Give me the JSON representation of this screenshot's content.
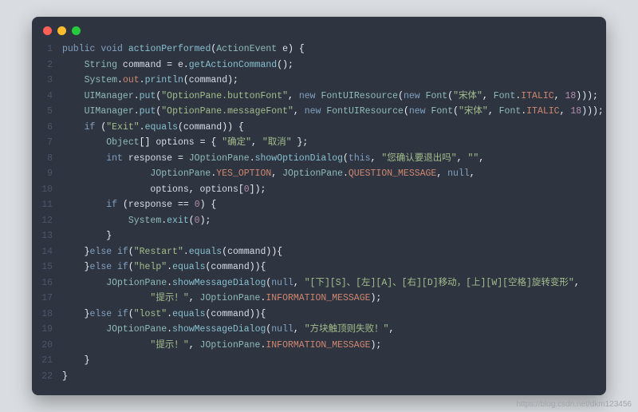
{
  "watermark": "https://blog.csdn.net/dkm123456",
  "lineCount": 22,
  "code": [
    [
      [
        "k",
        "public"
      ],
      [
        "v",
        " "
      ],
      [
        "k",
        "void"
      ],
      [
        "v",
        " "
      ],
      [
        "m",
        "actionPerformed"
      ],
      [
        "p",
        "("
      ],
      [
        "t",
        "ActionEvent"
      ],
      [
        "v",
        " e"
      ],
      [
        "p",
        ") {"
      ]
    ],
    [
      [
        "v",
        "    "
      ],
      [
        "t",
        "String"
      ],
      [
        "v",
        " command "
      ],
      [
        "p",
        "="
      ],
      [
        "v",
        " e"
      ],
      [
        "p",
        "."
      ],
      [
        "m",
        "getActionCommand"
      ],
      [
        "p",
        "();"
      ]
    ],
    [
      [
        "v",
        "    "
      ],
      [
        "t",
        "System"
      ],
      [
        "p",
        "."
      ],
      [
        "c",
        "out"
      ],
      [
        "p",
        "."
      ],
      [
        "m",
        "println"
      ],
      [
        "p",
        "("
      ],
      [
        "v",
        "command"
      ],
      [
        "p",
        ");"
      ]
    ],
    [
      [
        "v",
        "    "
      ],
      [
        "t",
        "UIManager"
      ],
      [
        "p",
        "."
      ],
      [
        "m",
        "put"
      ],
      [
        "p",
        "("
      ],
      [
        "s",
        "\"OptionPane.buttonFont\""
      ],
      [
        "p",
        ", "
      ],
      [
        "k",
        "new"
      ],
      [
        "v",
        " "
      ],
      [
        "t",
        "FontUIResource"
      ],
      [
        "p",
        "("
      ],
      [
        "k",
        "new"
      ],
      [
        "v",
        " "
      ],
      [
        "t",
        "Font"
      ],
      [
        "p",
        "("
      ],
      [
        "s",
        "\"宋体\""
      ],
      [
        "p",
        ", "
      ],
      [
        "t",
        "Font"
      ],
      [
        "p",
        "."
      ],
      [
        "c",
        "ITALIC"
      ],
      [
        "p",
        ", "
      ],
      [
        "n",
        "18"
      ],
      [
        "p",
        ")));"
      ]
    ],
    [
      [
        "v",
        "    "
      ],
      [
        "t",
        "UIManager"
      ],
      [
        "p",
        "."
      ],
      [
        "m",
        "put"
      ],
      [
        "p",
        "("
      ],
      [
        "s",
        "\"OptionPane.messageFont\""
      ],
      [
        "p",
        ", "
      ],
      [
        "k",
        "new"
      ],
      [
        "v",
        " "
      ],
      [
        "t",
        "FontUIResource"
      ],
      [
        "p",
        "("
      ],
      [
        "k",
        "new"
      ],
      [
        "v",
        " "
      ],
      [
        "t",
        "Font"
      ],
      [
        "p",
        "("
      ],
      [
        "s",
        "\"宋体\""
      ],
      [
        "p",
        ", "
      ],
      [
        "t",
        "Font"
      ],
      [
        "p",
        "."
      ],
      [
        "c",
        "ITALIC"
      ],
      [
        "p",
        ", "
      ],
      [
        "n",
        "18"
      ],
      [
        "p",
        ")));"
      ]
    ],
    [
      [
        "v",
        "    "
      ],
      [
        "k",
        "if"
      ],
      [
        "v",
        " "
      ],
      [
        "p",
        "("
      ],
      [
        "s",
        "\"Exit\""
      ],
      [
        "p",
        "."
      ],
      [
        "m",
        "equals"
      ],
      [
        "p",
        "("
      ],
      [
        "v",
        "command"
      ],
      [
        "p",
        ")) {"
      ]
    ],
    [
      [
        "v",
        "        "
      ],
      [
        "t",
        "Object"
      ],
      [
        "p",
        "[]"
      ],
      [
        "v",
        " options "
      ],
      [
        "p",
        "= { "
      ],
      [
        "s",
        "\"确定\""
      ],
      [
        "p",
        ", "
      ],
      [
        "s",
        "\"取消\""
      ],
      [
        "p",
        " };"
      ]
    ],
    [
      [
        "v",
        "        "
      ],
      [
        "k",
        "int"
      ],
      [
        "v",
        " response "
      ],
      [
        "p",
        "= "
      ],
      [
        "t",
        "JOptionPane"
      ],
      [
        "p",
        "."
      ],
      [
        "m",
        "showOptionDialog"
      ],
      [
        "p",
        "("
      ],
      [
        "k",
        "this"
      ],
      [
        "p",
        ", "
      ],
      [
        "s",
        "\"您确认要退出吗\""
      ],
      [
        "p",
        ", "
      ],
      [
        "s",
        "\"\""
      ],
      [
        "p",
        ","
      ]
    ],
    [
      [
        "v",
        "                "
      ],
      [
        "t",
        "JOptionPane"
      ],
      [
        "p",
        "."
      ],
      [
        "c",
        "YES_OPTION"
      ],
      [
        "p",
        ", "
      ],
      [
        "t",
        "JOptionPane"
      ],
      [
        "p",
        "."
      ],
      [
        "c",
        "QUESTION_MESSAGE"
      ],
      [
        "p",
        ", "
      ],
      [
        "k",
        "null"
      ],
      [
        "p",
        ","
      ]
    ],
    [
      [
        "v",
        "                options"
      ],
      [
        "p",
        ", "
      ],
      [
        "v",
        "options"
      ],
      [
        "p",
        "["
      ],
      [
        "n",
        "0"
      ],
      [
        "p",
        "]);"
      ]
    ],
    [
      [
        "v",
        "        "
      ],
      [
        "k",
        "if"
      ],
      [
        "v",
        " "
      ],
      [
        "p",
        "("
      ],
      [
        "v",
        "response "
      ],
      [
        "p",
        "== "
      ],
      [
        "n",
        "0"
      ],
      [
        "p",
        ") {"
      ]
    ],
    [
      [
        "v",
        "            "
      ],
      [
        "t",
        "System"
      ],
      [
        "p",
        "."
      ],
      [
        "m",
        "exit"
      ],
      [
        "p",
        "("
      ],
      [
        "n",
        "0"
      ],
      [
        "p",
        ");"
      ]
    ],
    [
      [
        "v",
        "        "
      ],
      [
        "p",
        "}"
      ]
    ],
    [
      [
        "v",
        "    "
      ],
      [
        "p",
        "}"
      ],
      [
        "k",
        "else"
      ],
      [
        "v",
        " "
      ],
      [
        "k",
        "if"
      ],
      [
        "p",
        "("
      ],
      [
        "s",
        "\"Restart\""
      ],
      [
        "p",
        "."
      ],
      [
        "m",
        "equals"
      ],
      [
        "p",
        "("
      ],
      [
        "v",
        "command"
      ],
      [
        "p",
        ")){"
      ]
    ],
    [
      [
        "v",
        "    "
      ],
      [
        "p",
        "}"
      ],
      [
        "k",
        "else"
      ],
      [
        "v",
        " "
      ],
      [
        "k",
        "if"
      ],
      [
        "p",
        "("
      ],
      [
        "s",
        "\"help\""
      ],
      [
        "p",
        "."
      ],
      [
        "m",
        "equals"
      ],
      [
        "p",
        "("
      ],
      [
        "v",
        "command"
      ],
      [
        "p",
        ")){"
      ]
    ],
    [
      [
        "v",
        "        "
      ],
      [
        "t",
        "JOptionPane"
      ],
      [
        "p",
        "."
      ],
      [
        "m",
        "showMessageDialog"
      ],
      [
        "p",
        "("
      ],
      [
        "k",
        "null"
      ],
      [
        "p",
        ", "
      ],
      [
        "s",
        "\"[下][S]、[左][A]、[右][D]移动，[上][W][空格]旋转变形\""
      ],
      [
        "p",
        ","
      ]
    ],
    [
      [
        "v",
        "                "
      ],
      [
        "s",
        "\"提示！\""
      ],
      [
        "p",
        ", "
      ],
      [
        "t",
        "JOptionPane"
      ],
      [
        "p",
        "."
      ],
      [
        "c",
        "INFORMATION_MESSAGE"
      ],
      [
        "p",
        ");"
      ]
    ],
    [
      [
        "v",
        "    "
      ],
      [
        "p",
        "}"
      ],
      [
        "k",
        "else"
      ],
      [
        "v",
        " "
      ],
      [
        "k",
        "if"
      ],
      [
        "p",
        "("
      ],
      [
        "s",
        "\"lost\""
      ],
      [
        "p",
        "."
      ],
      [
        "m",
        "equals"
      ],
      [
        "p",
        "("
      ],
      [
        "v",
        "command"
      ],
      [
        "p",
        ")){"
      ]
    ],
    [
      [
        "v",
        "        "
      ],
      [
        "t",
        "JOptionPane"
      ],
      [
        "p",
        "."
      ],
      [
        "m",
        "showMessageDialog"
      ],
      [
        "p",
        "("
      ],
      [
        "k",
        "null"
      ],
      [
        "p",
        ", "
      ],
      [
        "s",
        "\"方块触顶则失败！\""
      ],
      [
        "p",
        ","
      ]
    ],
    [
      [
        "v",
        "                "
      ],
      [
        "s",
        "\"提示！\""
      ],
      [
        "p",
        ", "
      ],
      [
        "t",
        "JOptionPane"
      ],
      [
        "p",
        "."
      ],
      [
        "c",
        "INFORMATION_MESSAGE"
      ],
      [
        "p",
        ");"
      ]
    ],
    [
      [
        "v",
        "    "
      ],
      [
        "p",
        "}"
      ]
    ],
    [
      [
        "p",
        "}"
      ]
    ]
  ]
}
